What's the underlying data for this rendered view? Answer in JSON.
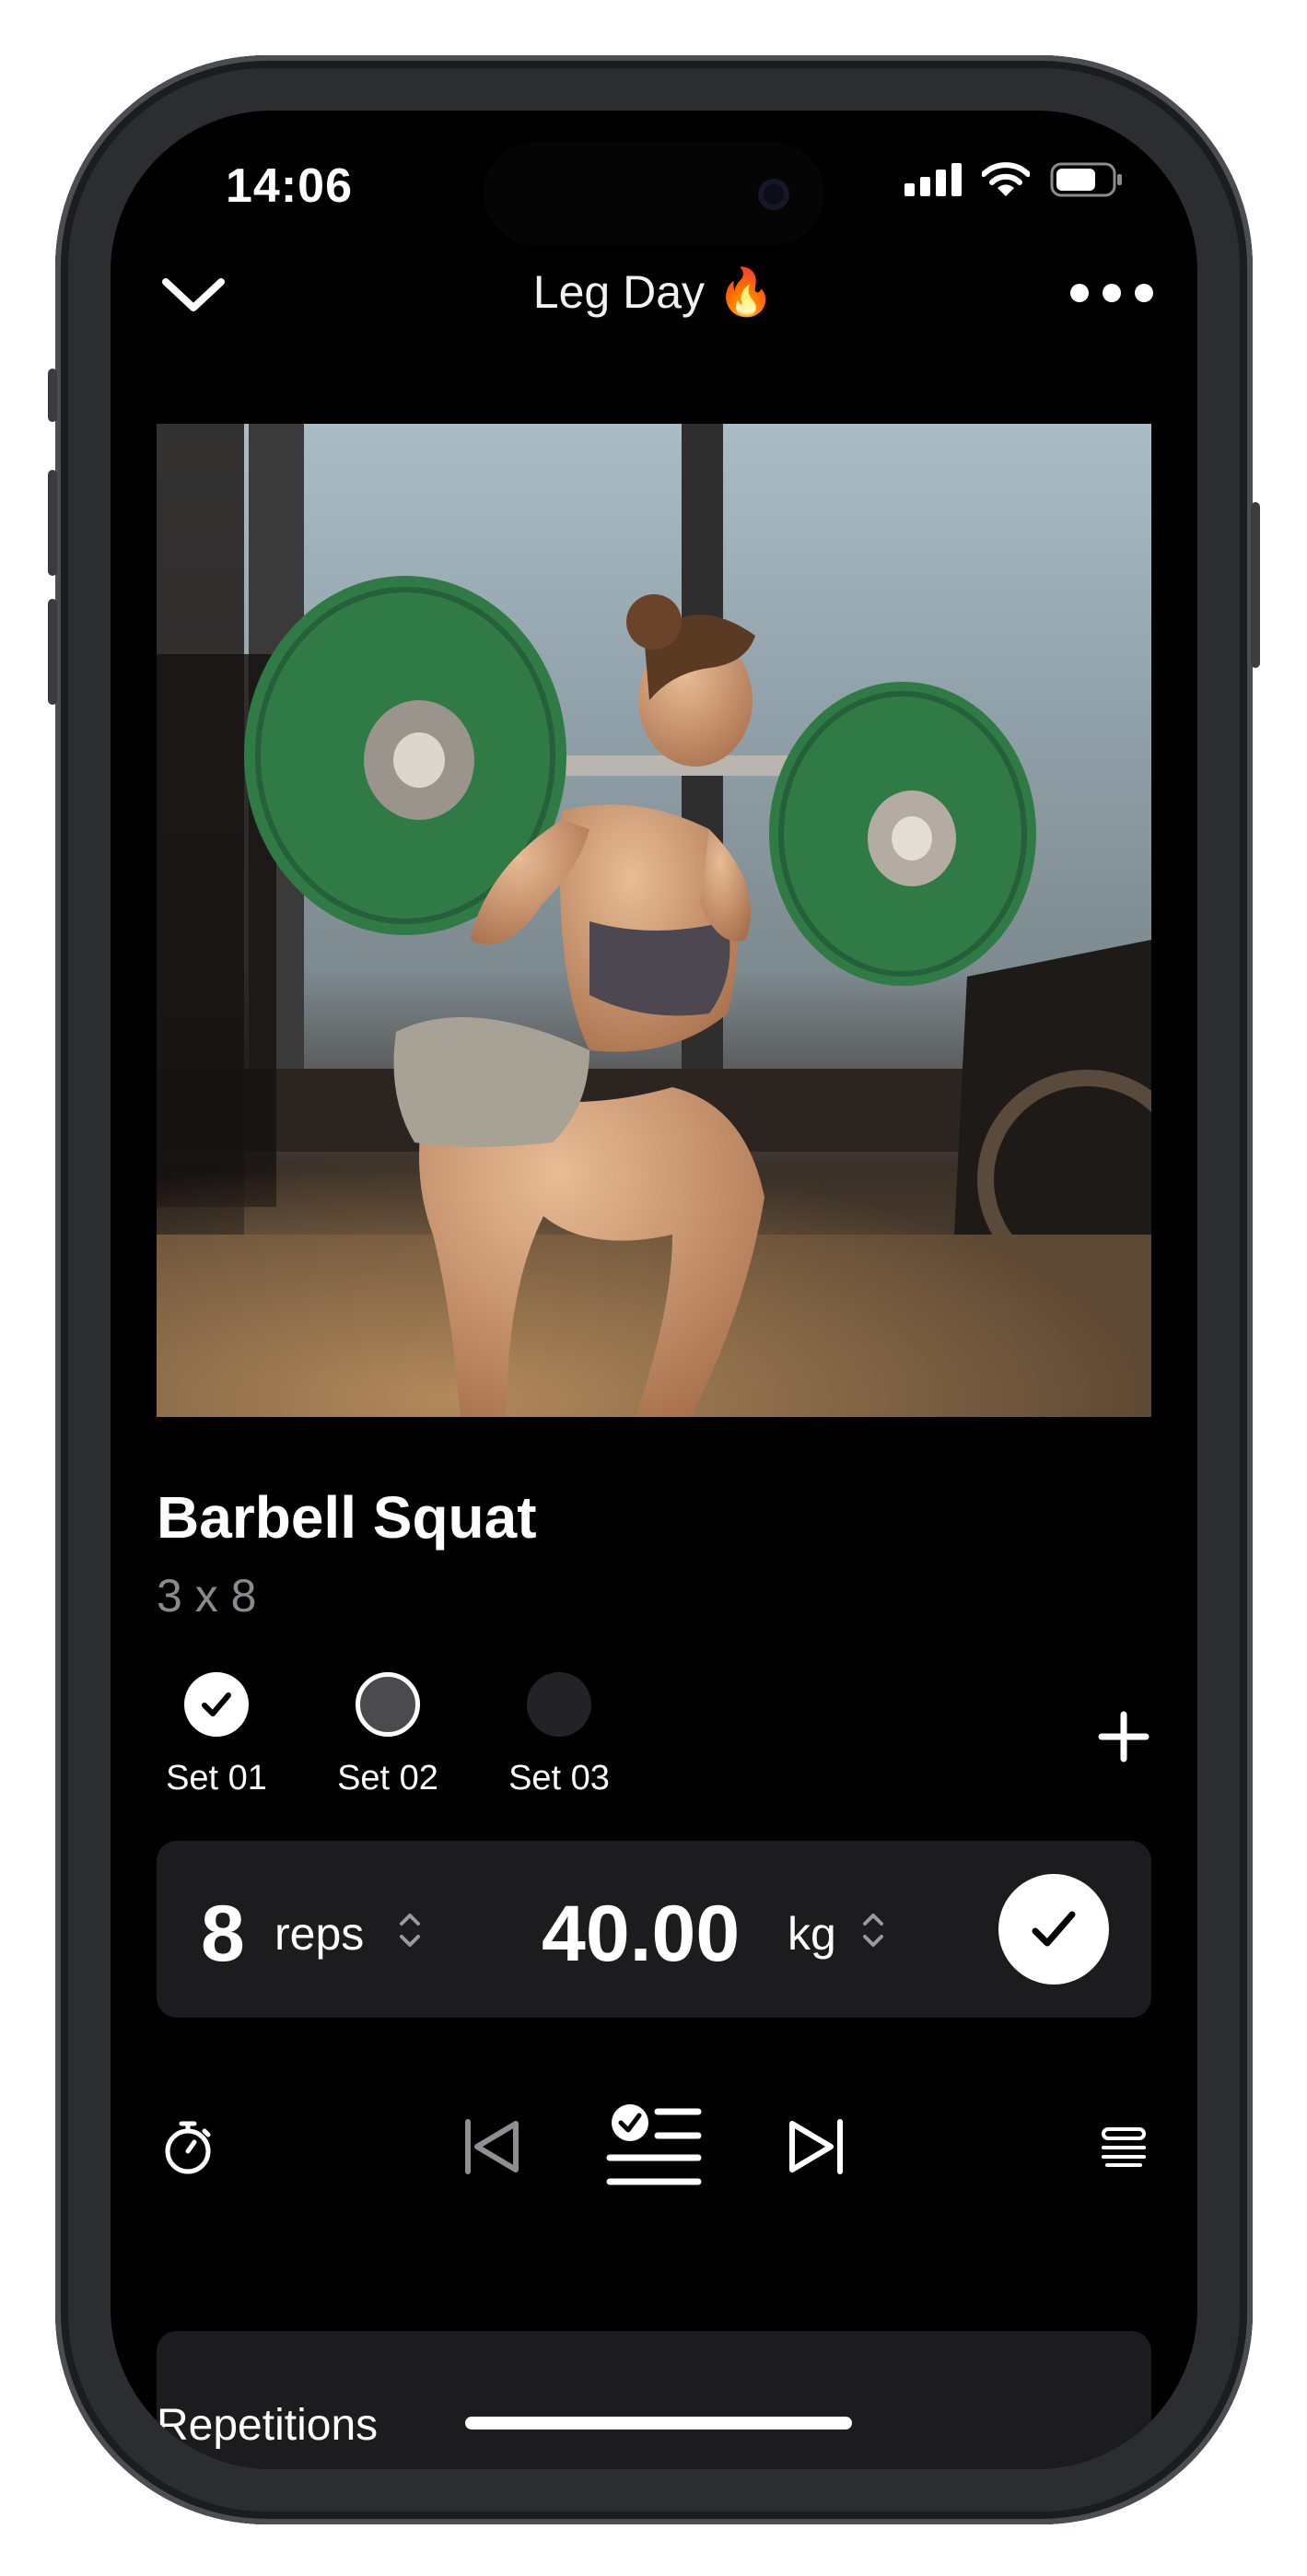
{
  "status_bar": {
    "time": "14:06"
  },
  "header": {
    "title": "Leg Day 🔥"
  },
  "exercise": {
    "name": "Barbell Squat",
    "scheme": "3 x 8"
  },
  "sets": [
    {
      "label": "Set 01",
      "state": "done"
    },
    {
      "label": "Set 02",
      "state": "current"
    },
    {
      "label": "Set 03",
      "state": "upcoming"
    }
  ],
  "entry": {
    "reps": "8",
    "reps_unit": "reps",
    "weight": "40.00",
    "weight_unit": "kg"
  },
  "toolbar": {
    "icons": [
      "stopwatch-icon",
      "skip-back-icon",
      "checklist-icon",
      "skip-forward-icon",
      "stack-icon"
    ]
  },
  "card": {
    "title": "Repetitions"
  },
  "colors": {
    "background": "#000000",
    "panel": "#1c1c1e",
    "plate_green": "#2f7a45",
    "text_secondary": "#8a8a8d"
  }
}
